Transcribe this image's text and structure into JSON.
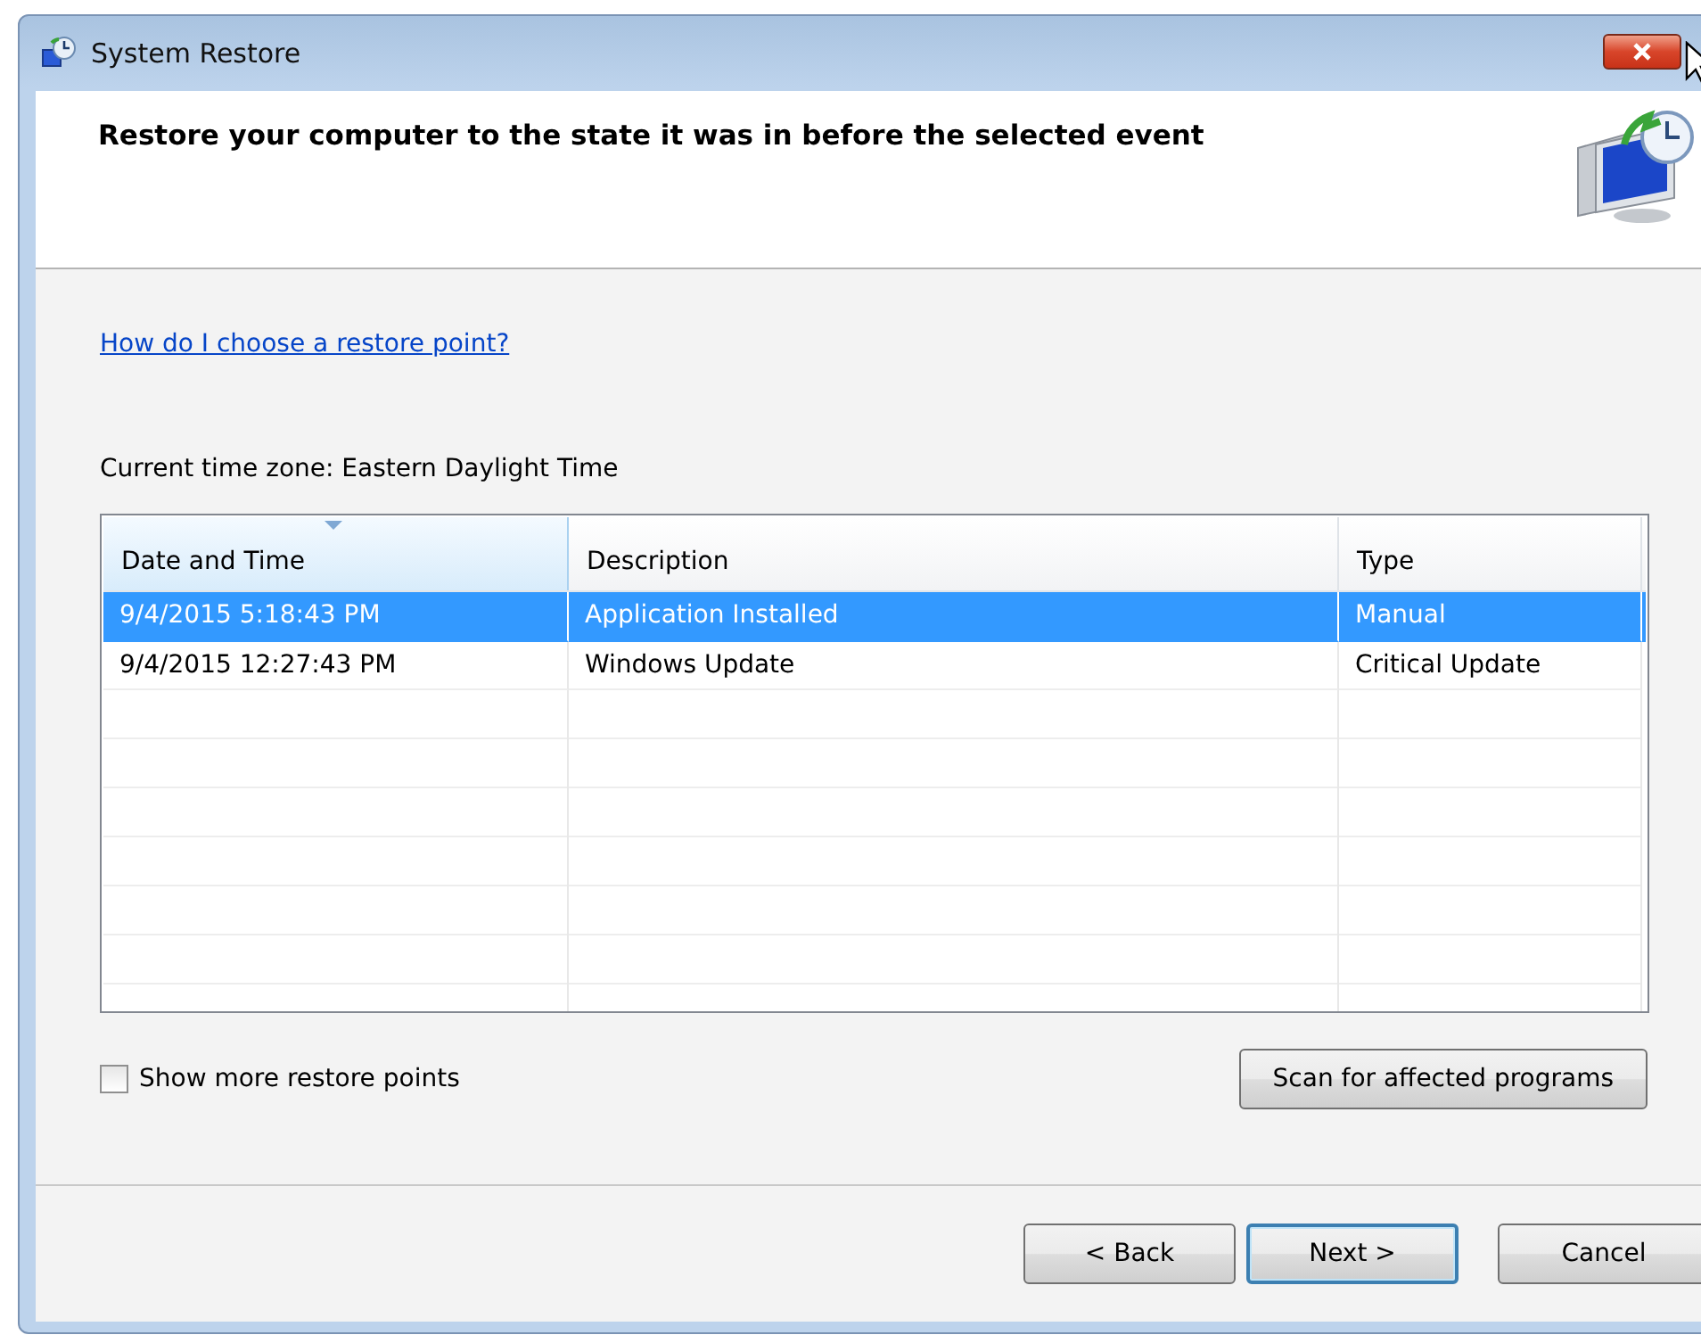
{
  "window": {
    "title": "System Restore"
  },
  "header": {
    "heading": "Restore your computer to the state it was in before the selected event"
  },
  "help_link": "How do I choose a restore point?",
  "timezone": "Current time zone: Eastern Daylight Time",
  "table": {
    "columns": [
      {
        "label": "Date and Time",
        "sorted": true
      },
      {
        "label": "Description",
        "sorted": false
      },
      {
        "label": "Type",
        "sorted": false
      }
    ],
    "rows": [
      {
        "cells": [
          "9/4/2015 5:18:43 PM",
          "Application Installed",
          "Manual"
        ],
        "selected": true
      },
      {
        "cells": [
          "9/4/2015 12:27:43 PM",
          "Windows Update",
          "Critical Update"
        ],
        "selected": false
      }
    ]
  },
  "show_more": {
    "label": "Show more restore points",
    "checked": false
  },
  "scan_button": "Scan for affected programs",
  "buttons": [
    {
      "label": "< Back",
      "default": false
    },
    {
      "label": "Next >",
      "default": true
    },
    {
      "label": "Cancel",
      "default": false
    }
  ]
}
